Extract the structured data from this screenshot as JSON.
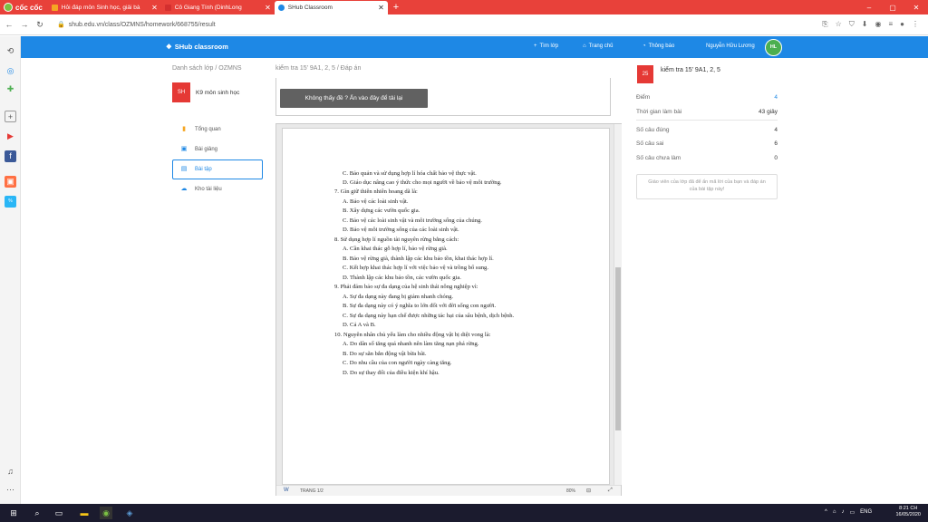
{
  "browser": {
    "brand": "cốc cốc",
    "tabs": [
      {
        "title": "Hỏi đáp môn Sinh học, giải bà",
        "favicon_color": "#f5a623"
      },
      {
        "title": "Cô Giang Tính (DinhLong",
        "favicon_color": "#d32f2f"
      },
      {
        "title": "SHub Classroom",
        "favicon_color": "#1e88e5"
      }
    ],
    "new_tab": "+",
    "window_controls": [
      "–",
      "▢",
      "✕"
    ],
    "url": "shub.edu.vn/class/OZMNS/homework/668755/result"
  },
  "app": {
    "logo": "SHub classroom",
    "nav": [
      {
        "icon": "plus-icon",
        "label": "Tìm lớp"
      },
      {
        "icon": "home-icon",
        "label": "Trang chủ"
      },
      {
        "icon": "bell-icon",
        "label": "Thông báo"
      }
    ],
    "user_name": "Nguyễn Hữu Lương",
    "user_initials": "HL"
  },
  "sidebar": {
    "breadcrumb": "Danh sách lớp  /  OZMNS",
    "class_badge": "SH",
    "class_name": "K9 môn sinh học",
    "items": [
      {
        "label": "Tổng quan",
        "icon": "bar-chart-icon",
        "active": false
      },
      {
        "label": "Bài giảng",
        "icon": "play-icon",
        "active": false
      },
      {
        "label": "Bài tập",
        "icon": "document-icon",
        "active": true
      },
      {
        "label": "Kho tài liệu",
        "icon": "cloud-icon",
        "active": false
      }
    ]
  },
  "content": {
    "breadcrumb": "kiểm tra 15' 9A1, 2, 5  /  Đáp án",
    "reload_text": "Không thấy đề ? Ấn vào đây để tải lại",
    "doc_lines": [
      "C. Bảo quản và sử dụng hợp lí hóa chất bảo vệ thực vật.",
      "D. Giáo dục nâng cao ý thức cho mọi người về bảo vệ môi trường.",
      "7.  Gìn giữ thiên nhiên hoang dã là:",
      "A. Bảo vệ các loài sinh vật.",
      "B. Xây dựng các vườn quốc gia.",
      "C. Bảo vệ các loài sinh vật và môi trường sống của chúng.",
      "D. Bảo vệ môi trường sống của các loài sinh vật.",
      "8.  Sử dụng hợp lí nguồn tài nguyên rừng bằng cách:",
      "A. Cần khai thác gỗ hợp lí, bảo vệ rừng già.",
      "B. Bảo vệ rừng già, thành lập các khu bảo tồn, khai thác hợp lí.",
      "C. Kết hợp khai thác hợp lí với việc bảo vệ và trồng bổ sung.",
      "D. Thành lập các khu bảo tồn, các vườn quốc gia.",
      "9.  Phải đảm bảo sự đa dạng của hệ sinh thái nông nghiệp vì:",
      "A. Sự đa dạng này đang bị giảm nhanh chóng.",
      "B. Sự đa dạng này có ý nghĩa to lớn đối với đời sống con người.",
      "C. Sự đa dạng này hạn chế được những tác hại của sâu bệnh, dịch bệnh.",
      "D. Cả A và B.",
      "10. Nguyên nhân chủ yếu làm cho nhiều động vật bị diệt vong là:",
      "A. Do dân số tăng quá nhanh nên làm tăng nạn phá rừng.",
      "B. Do sự săn bắn động vật bừa bãi.",
      "C. Do nhu cầu của con người ngày càng tăng.",
      "D. Do sự thay đổi của điều kiện khí hậu."
    ],
    "page_indicator": "TRANG 1/2",
    "zoom": "80%"
  },
  "result": {
    "badge": "25",
    "title": "kiểm tra 15' 9A1, 2, 5",
    "score_label": "Điểm",
    "score": "4",
    "time_label": "Thời gian làm bài",
    "time": "43 giây",
    "correct_label": "Số câu đúng",
    "correct": "4",
    "wrong_label": "Số câu sai",
    "wrong": "6",
    "undone_label": "Số câu chưa làm",
    "undone": "0",
    "notice": "Giáo viên của lớp đã để ẩn mã lời của bạn và đáp án của bài tập này!"
  },
  "taskbar": {
    "time": "8:21 CH",
    "date": "16/05/2020",
    "lang": "ENG"
  }
}
